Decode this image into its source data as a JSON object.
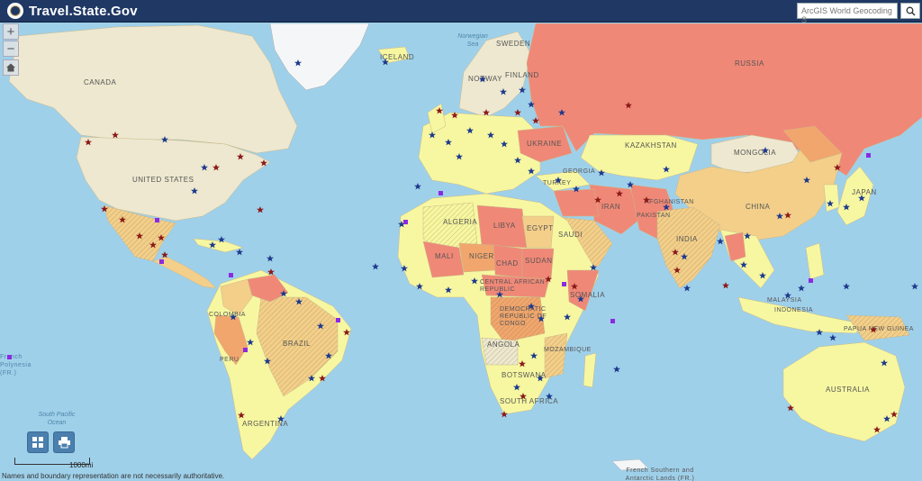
{
  "header": {
    "title": "Travel.State.Gov",
    "search_placeholder": "ArcGIS World Geocoding S"
  },
  "controls": {
    "zoom_in": "+",
    "zoom_out": "−"
  },
  "scale": {
    "label": "1000mi"
  },
  "attribution": "Names and boundary representation are not necessarily authoritative.",
  "country_labels": {
    "canada": "CANADA",
    "united_states": "UNITED STATES",
    "russia": "RUSSIA",
    "sweden": "SWEDEN",
    "finland": "FINLAND",
    "norway": "NORWAY",
    "iceland": "ICELAND",
    "ukraine": "UKRAINE",
    "kazakhstan": "KAZAKHSTAN",
    "mongolia": "MONGOLIA",
    "china": "CHINA",
    "japan": "JAPAN",
    "iran": "IRAN",
    "afghanistan": "AFGHANISTAN",
    "pakistan": "PAKISTAN",
    "india": "INDIA",
    "algeria": "ALGERIA",
    "libya": "LIBYA",
    "egypt": "EGYPT",
    "saudi": "SAUDI",
    "mali": "MALI",
    "niger": "NIGER",
    "chad": "CHAD",
    "sudan": "SUDAN",
    "car": "CENTRAL AFRICAN REPUBLIC",
    "somalia": "SOMALIA",
    "drc": "DEMOCRATIC REPUBLIC OF CONGO",
    "angola": "ANGOLA",
    "mozambique": "MOZAMBIQUE",
    "botswana": "BOTSWANA",
    "south_africa": "SOUTH AFRICA",
    "colombia": "COLOMBIA",
    "brazil": "BRAZIL",
    "argentina": "ARGENTINA",
    "peru": "PERU",
    "australia": "AUSTRALIA",
    "indonesia": "INDONESIA",
    "malaysia": "MALAYSIA",
    "papua": "PAPUA NEW GUINEA",
    "georgia": "GEORGIA",
    "turkey": "TURKEY",
    "french_polynesia": "French Polynesia (FR.)",
    "french_southern": "French Southern and Antarctic Lands (FR.)"
  },
  "ocean_labels": {
    "norwegian_sea": "Norwegian Sea",
    "south_pacific": "South Pacific Ocean"
  },
  "colors": {
    "ocean": "#9fd0ea",
    "level1": "#f7f7a1",
    "level2": "#f3cf8a",
    "level3": "#f1a66d",
    "level4": "#f08877",
    "neutral": "#ede8cf",
    "star_blue": "#1e3a8c",
    "star_red": "#8b1a1a",
    "embassy_purple": "#8a2be2"
  }
}
